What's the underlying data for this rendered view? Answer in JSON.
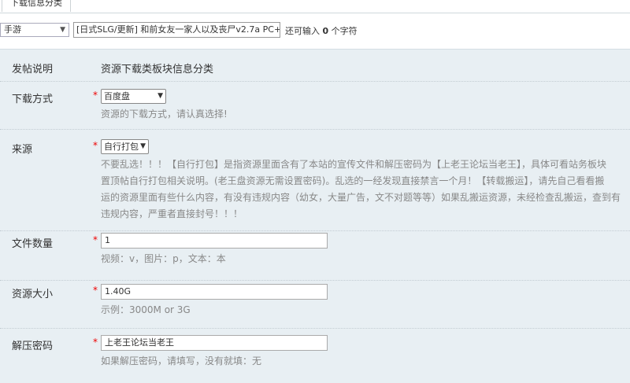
{
  "tab": {
    "label": "下载信息分类"
  },
  "top": {
    "category_value": "手游",
    "title_value": "[日式SLG/更新] 和前女友一家人以及丧尸v2.7a PC+安卓",
    "remain_prefix": "还可输入",
    "remain_count": "0",
    "remain_suffix": "个字符"
  },
  "form": {
    "post_note": {
      "label": "发帖说明",
      "value": "资源下载类板块信息分类"
    },
    "download": {
      "label": "下载方式",
      "required": "*",
      "value": "百度盘",
      "hint": "资源的下载方式，请认真选择!"
    },
    "source": {
      "label": "来源",
      "required": "*",
      "value": "自行打包",
      "hint_lines": [
        "不要乱选！！！【自行打包】是指资源里面含有了本站的宣传文件和解压密码为【上老王论坛当老王】，具体可看站务板块",
        "置顶帖自行打包相关说明。(老王盘资源无需设置密码)。乱选的一经发现直接禁言一个月！【转载搬运】，请先自己看看搬",
        "运的资源里面有些什么内容，有没有违规内容（幼女，大量广告，文不对题等等）如果乱搬运资源，未经检查乱搬运，查到有",
        "违规内容，严重者直接封号！！！"
      ]
    },
    "file_count": {
      "label": "文件数量",
      "required": "*",
      "value": "1",
      "hint": "视频：v，图片：p，文本：本"
    },
    "size": {
      "label": "资源大小",
      "required": "*",
      "value": "1.40G",
      "hint": "示例：3000M or 3G"
    },
    "password": {
      "label": "解压密码",
      "required": "*",
      "value": "上老王论坛当老王",
      "hint": "如果解压密码，请填写，没有就填：无"
    }
  }
}
